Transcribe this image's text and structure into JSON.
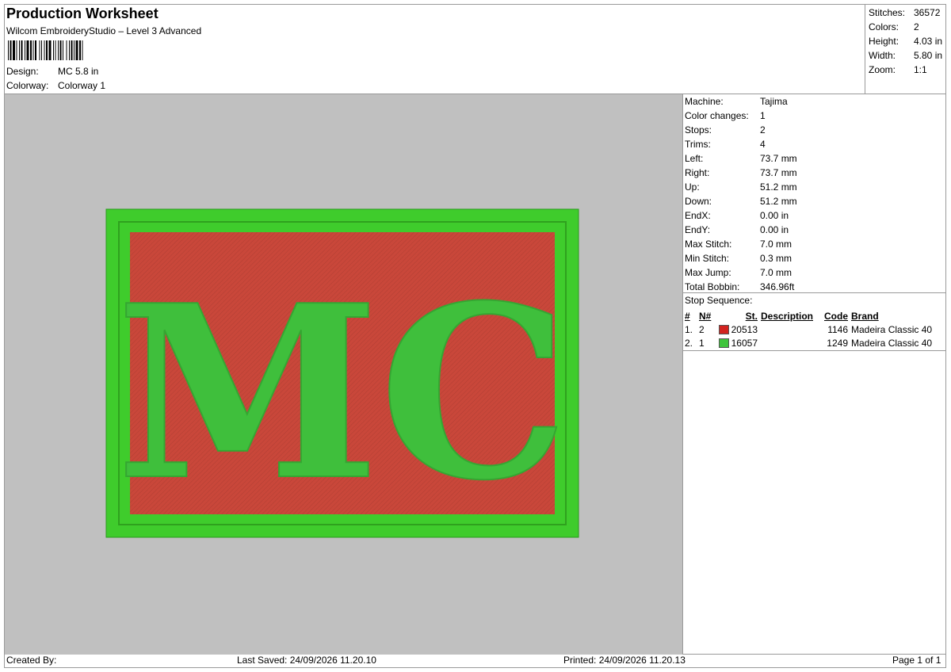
{
  "header": {
    "title": "Production Worksheet",
    "subtitle": "Wilcom EmbroideryStudio – Level 3 Advanced",
    "design_label": "Design:",
    "design_value": "MC 5.8 in",
    "colorway_label": "Colorway:",
    "colorway_value": "Colorway 1"
  },
  "summary": [
    {
      "label": "Stitches:",
      "value": "36572"
    },
    {
      "label": "Colors:",
      "value": "2"
    },
    {
      "label": "Height:",
      "value": "4.03 in"
    },
    {
      "label": "Width:",
      "value": "5.80 in"
    },
    {
      "label": "Zoom:",
      "value": "1:1"
    }
  ],
  "machine_info": [
    {
      "label": "Machine:",
      "value": "Tajima"
    },
    {
      "label": "Color changes:",
      "value": "1"
    },
    {
      "label": "Stops:",
      "value": "2"
    },
    {
      "label": "Trims:",
      "value": "4"
    },
    {
      "label": "Left:",
      "value": "73.7 mm"
    },
    {
      "label": "Right:",
      "value": "73.7 mm"
    },
    {
      "label": "Up:",
      "value": "51.2 mm"
    },
    {
      "label": "Down:",
      "value": "51.2 mm"
    },
    {
      "label": "EndX:",
      "value": "0.00 in"
    },
    {
      "label": "EndY:",
      "value": "0.00 in"
    },
    {
      "label": "Max Stitch:",
      "value": "7.0 mm"
    },
    {
      "label": "Min Stitch:",
      "value": "0.3 mm"
    },
    {
      "label": "Max Jump:",
      "value": "7.0 mm"
    },
    {
      "label": "Total Bobbin:",
      "value": "346.96ft"
    }
  ],
  "stop_sequence": {
    "title": "Stop Sequence:",
    "headers": {
      "order": "#",
      "n": "N#",
      "stitches": "St.",
      "description": "Description",
      "code": "Code",
      "brand": "Brand"
    },
    "rows": [
      {
        "order": "1.",
        "n": "2",
        "color": "#d2231f",
        "stitches": "20513",
        "description": "",
        "code": "1146",
        "brand": "Madeira Classic 40"
      },
      {
        "order": "2.",
        "n": "1",
        "color": "#3fc43c",
        "stitches": "16057",
        "description": "",
        "code": "1249",
        "brand": "Madeira Classic 40"
      }
    ]
  },
  "design_preview": {
    "text": "MC",
    "fill_color": "#c9473a",
    "border_color": "#3fcc2c",
    "letter_color": "#3fbf3c"
  },
  "footer": {
    "created_by": "Created By:",
    "last_saved": "Last Saved: 24/09/2026 11.20.10",
    "printed": "Printed: 24/09/2026 11.20.13",
    "page": "Page 1 of 1"
  }
}
